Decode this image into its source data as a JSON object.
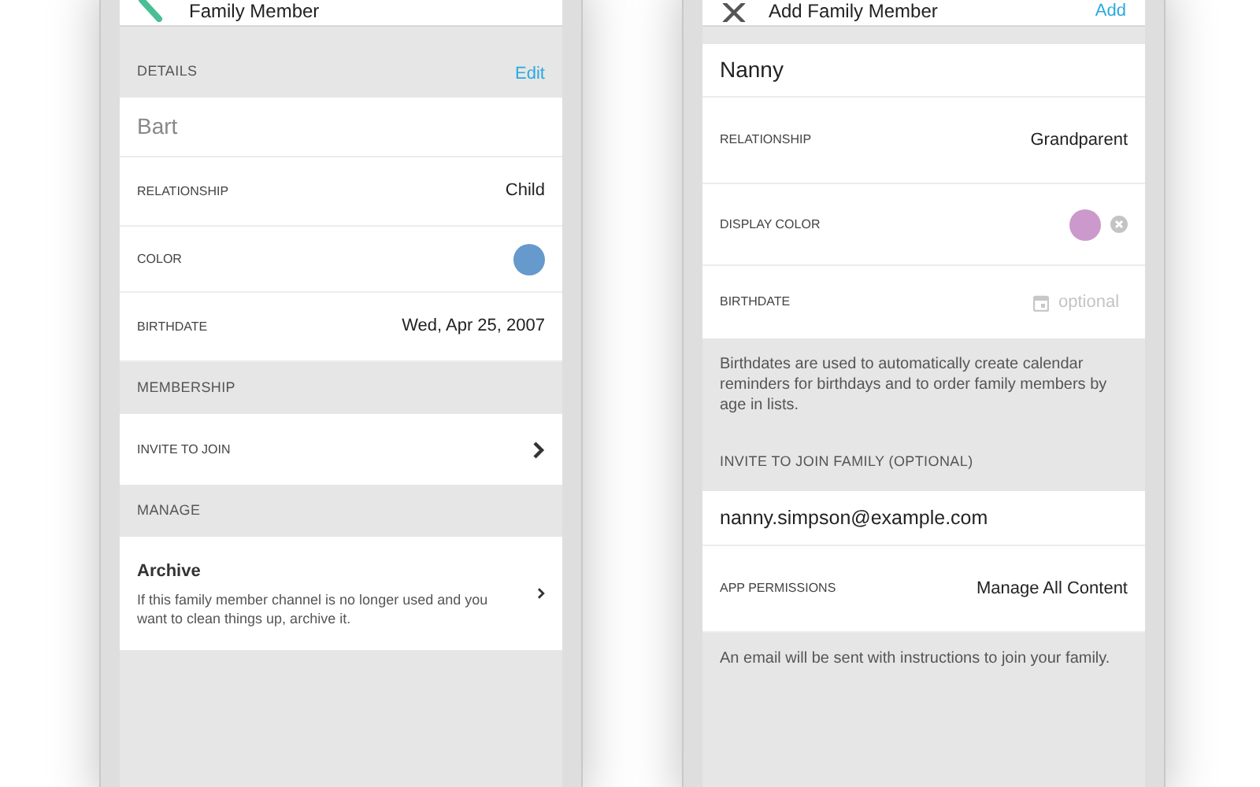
{
  "screens": [
    {
      "header": {
        "title": "Family Member",
        "kind": "back"
      },
      "rows": [
        {
          "kind": "header",
          "label": "DETAILS",
          "action": "Edit"
        },
        {
          "kind": "name",
          "value": "Bart",
          "disabled": true
        },
        {
          "kind": "field",
          "label": "RELATIONSHIP",
          "value": "Child"
        },
        {
          "kind": "color",
          "label": "COLOR",
          "color": "#6699cc",
          "clearable": false
        },
        {
          "kind": "field",
          "label": "BIRTHDATE",
          "value": "Wed, Apr 25, 2007"
        },
        {
          "kind": "header",
          "label": "MEMBERSHIP"
        },
        {
          "kind": "link",
          "label": "INVITE TO JOIN"
        },
        {
          "kind": "header",
          "label": "MANAGE"
        },
        {
          "kind": "detail_link",
          "title": "Archive",
          "description": "If this family member channel is no longer used and you want to clean things up, archive it."
        }
      ]
    },
    {
      "header": {
        "title": "Add Family Member",
        "kind": "close",
        "action": "Add"
      },
      "rows": [
        {
          "kind": "name",
          "value": "Nanny",
          "disabled": false
        },
        {
          "kind": "field",
          "label": "RELATIONSHIP",
          "value": "Grandparent"
        },
        {
          "kind": "color",
          "label": "DISPLAY COLOR",
          "color": "#cc99cc",
          "clearable": true
        },
        {
          "kind": "date",
          "label": "BIRTHDATE",
          "placeholder": "optional"
        },
        {
          "kind": "note",
          "text": "Birthdates are used to automatically create calendar reminders for birthdays and to order family members by age in lists."
        },
        {
          "kind": "header",
          "label": "INVITE TO JOIN FAMILY (OPTIONAL)"
        },
        {
          "kind": "input",
          "value": "nanny.simpson@example.com"
        },
        {
          "kind": "field",
          "label": "APP PERMISSIONS",
          "value": "Manage All Content"
        },
        {
          "kind": "note",
          "text": "An email will be sent with instructions to join your family."
        }
      ]
    }
  ]
}
